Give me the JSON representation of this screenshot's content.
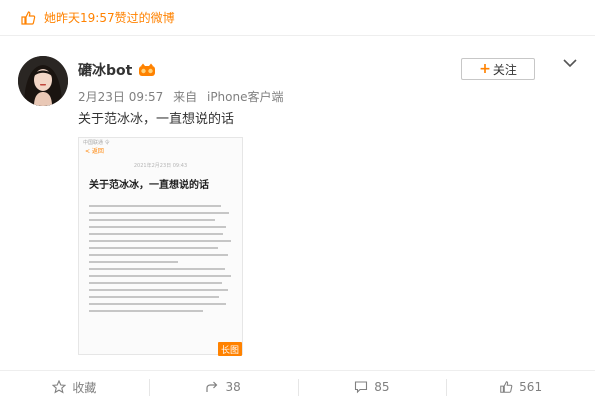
{
  "liked_banner": {
    "text": "她昨天19:57赞过的微博"
  },
  "author": {
    "name": "礳冰bot"
  },
  "post": {
    "date": "2月23日 09:57",
    "source_prefix": "来自",
    "source": "iPhone客户端",
    "text": "关于范冰冰，一直想说的话"
  },
  "follow": {
    "label": "关注"
  },
  "long_image": {
    "status": "中国联通 令",
    "back": "< 返回",
    "date": "2021年2月23日 09:43",
    "title": "关于范冰冰，一直想说的话",
    "badge": "长图"
  },
  "actions": {
    "favorite": {
      "label": "收藏"
    },
    "forward": {
      "count": "38"
    },
    "comment": {
      "count": "85"
    },
    "like": {
      "count": "561"
    }
  },
  "colors": {
    "accent": "#ff8200",
    "muted": "#808080"
  }
}
